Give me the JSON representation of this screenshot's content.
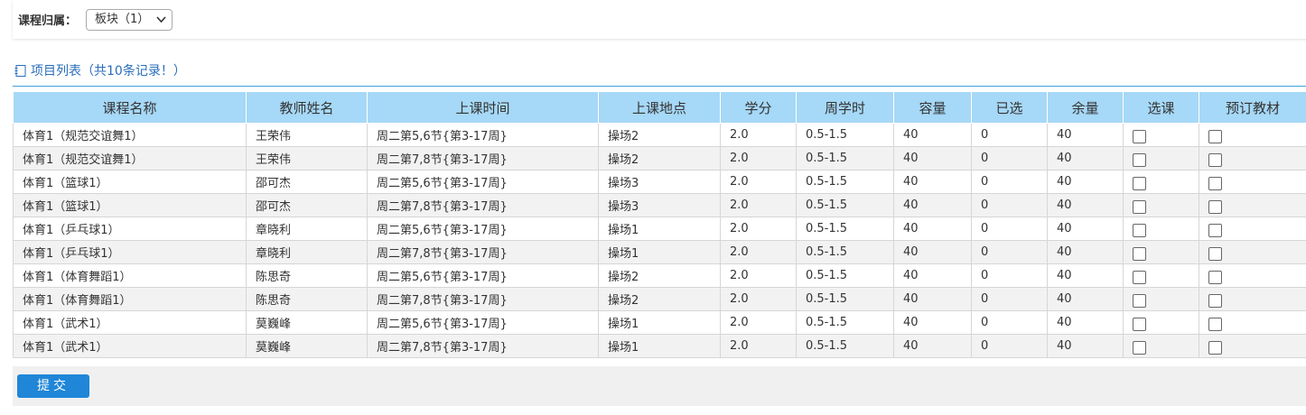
{
  "filter": {
    "label": "课程归属：",
    "selected": "板块（1）"
  },
  "list": {
    "title": "项目列表（共10条记录！）"
  },
  "table": {
    "headers": [
      "课程名称",
      "教师姓名",
      "上课时间",
      "上课地点",
      "学分",
      "周学时",
      "容量",
      "已选",
      "余量",
      "选课",
      "预订教材"
    ],
    "rows": [
      {
        "course": "体育1（规范交谊舞1）",
        "teacher": "王荣伟",
        "time": "周二第5,6节{第3-17周}",
        "place": "操场2",
        "credit": "2.0",
        "hours": "0.5-1.5",
        "capacity": "40",
        "selected": "0",
        "remain": "40"
      },
      {
        "course": "体育1（规范交谊舞1）",
        "teacher": "王荣伟",
        "time": "周二第7,8节{第3-17周}",
        "place": "操场2",
        "credit": "2.0",
        "hours": "0.5-1.5",
        "capacity": "40",
        "selected": "0",
        "remain": "40"
      },
      {
        "course": "体育1（篮球1）",
        "teacher": "邵可杰",
        "time": "周二第5,6节{第3-17周}",
        "place": "操场3",
        "credit": "2.0",
        "hours": "0.5-1.5",
        "capacity": "40",
        "selected": "0",
        "remain": "40"
      },
      {
        "course": "体育1（篮球1）",
        "teacher": "邵可杰",
        "time": "周二第7,8节{第3-17周}",
        "place": "操场3",
        "credit": "2.0",
        "hours": "0.5-1.5",
        "capacity": "40",
        "selected": "0",
        "remain": "40"
      },
      {
        "course": "体育1（乒乓球1）",
        "teacher": "章晓利",
        "time": "周二第5,6节{第3-17周}",
        "place": "操场1",
        "credit": "2.0",
        "hours": "0.5-1.5",
        "capacity": "40",
        "selected": "0",
        "remain": "40"
      },
      {
        "course": "体育1（乒乓球1）",
        "teacher": "章晓利",
        "time": "周二第7,8节{第3-17周}",
        "place": "操场1",
        "credit": "2.0",
        "hours": "0.5-1.5",
        "capacity": "40",
        "selected": "0",
        "remain": "40"
      },
      {
        "course": "体育1（体育舞蹈1）",
        "teacher": "陈思奇",
        "time": "周二第5,6节{第3-17周}",
        "place": "操场2",
        "credit": "2.0",
        "hours": "0.5-1.5",
        "capacity": "40",
        "selected": "0",
        "remain": "40"
      },
      {
        "course": "体育1（体育舞蹈1）",
        "teacher": "陈思奇",
        "time": "周二第7,8节{第3-17周}",
        "place": "操场2",
        "credit": "2.0",
        "hours": "0.5-1.5",
        "capacity": "40",
        "selected": "0",
        "remain": "40"
      },
      {
        "course": "体育1（武术1）",
        "teacher": "莫巍峰",
        "time": "周二第5,6节{第3-17周}",
        "place": "操场1",
        "credit": "2.0",
        "hours": "0.5-1.5",
        "capacity": "40",
        "selected": "0",
        "remain": "40"
      },
      {
        "course": "体育1（武术1）",
        "teacher": "莫巍峰",
        "time": "周二第7,8节{第3-17周}",
        "place": "操场1",
        "credit": "2.0",
        "hours": "0.5-1.5",
        "capacity": "40",
        "selected": "0",
        "remain": "40"
      }
    ]
  },
  "actions": {
    "submit_label": "提交"
  },
  "colors": {
    "header_bg": "#a6d8f7",
    "link": "#2a6ebb",
    "button": "#1f86d8",
    "rule": "#3fa3d8"
  },
  "icons": {
    "list_icon": "notebook-icon",
    "select_chevron": "chevron-down-icon"
  }
}
